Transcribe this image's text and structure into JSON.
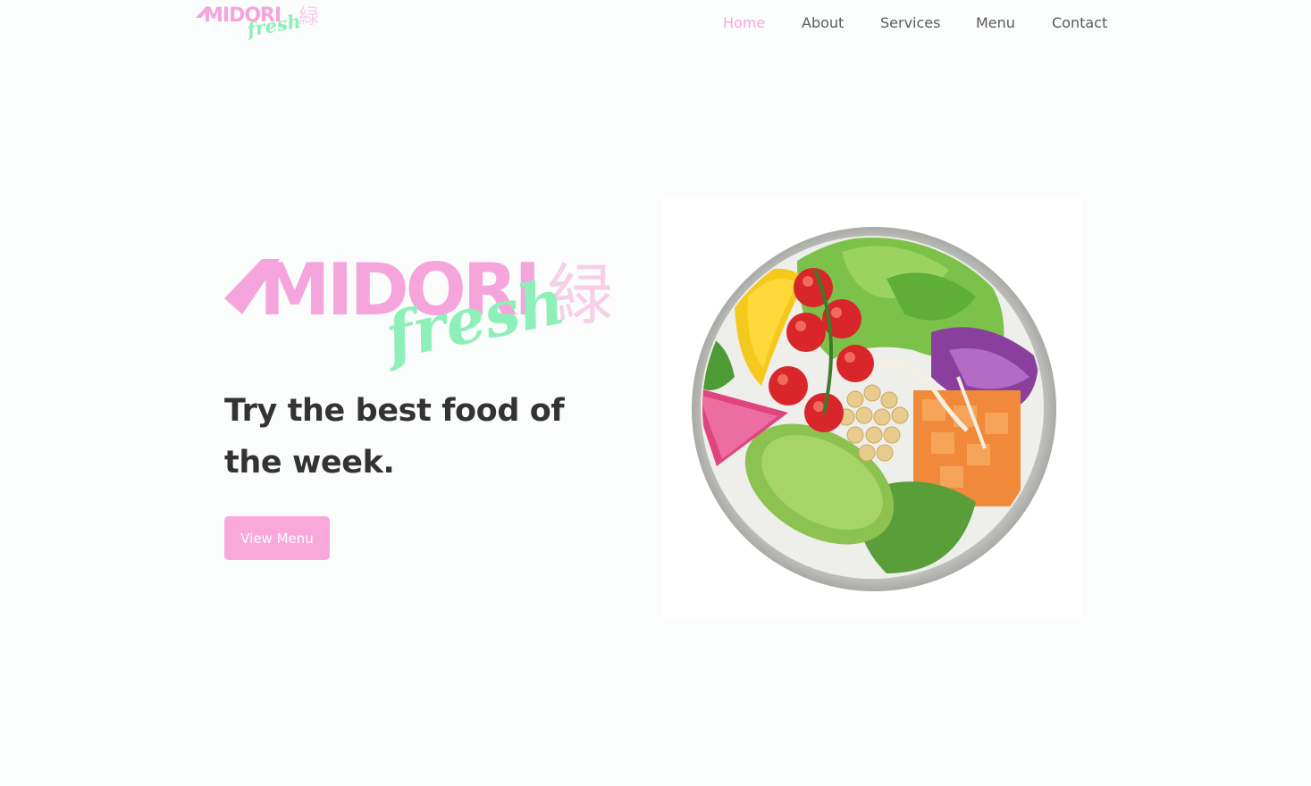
{
  "brand": {
    "name": "MIDORI",
    "script": "fresh",
    "kanji": "緑"
  },
  "nav": {
    "items": [
      {
        "label": "Home",
        "active": true
      },
      {
        "label": "About",
        "active": false
      },
      {
        "label": "Services",
        "active": false
      },
      {
        "label": "Menu",
        "active": false
      },
      {
        "label": "Contact",
        "active": false
      }
    ]
  },
  "hero": {
    "heading_line1": "Try the best food of",
    "heading_line2": "the week.",
    "cta_label": "View Menu",
    "image_icon": "salad-bowl-image"
  },
  "colors": {
    "brand_pink": "#f5a5dc",
    "brand_green": "#8ef0b8",
    "kanji_pink": "#f8cfe9",
    "heading": "#333333",
    "nav_text": "#5a5a5a",
    "background": "#fbfdfd"
  }
}
